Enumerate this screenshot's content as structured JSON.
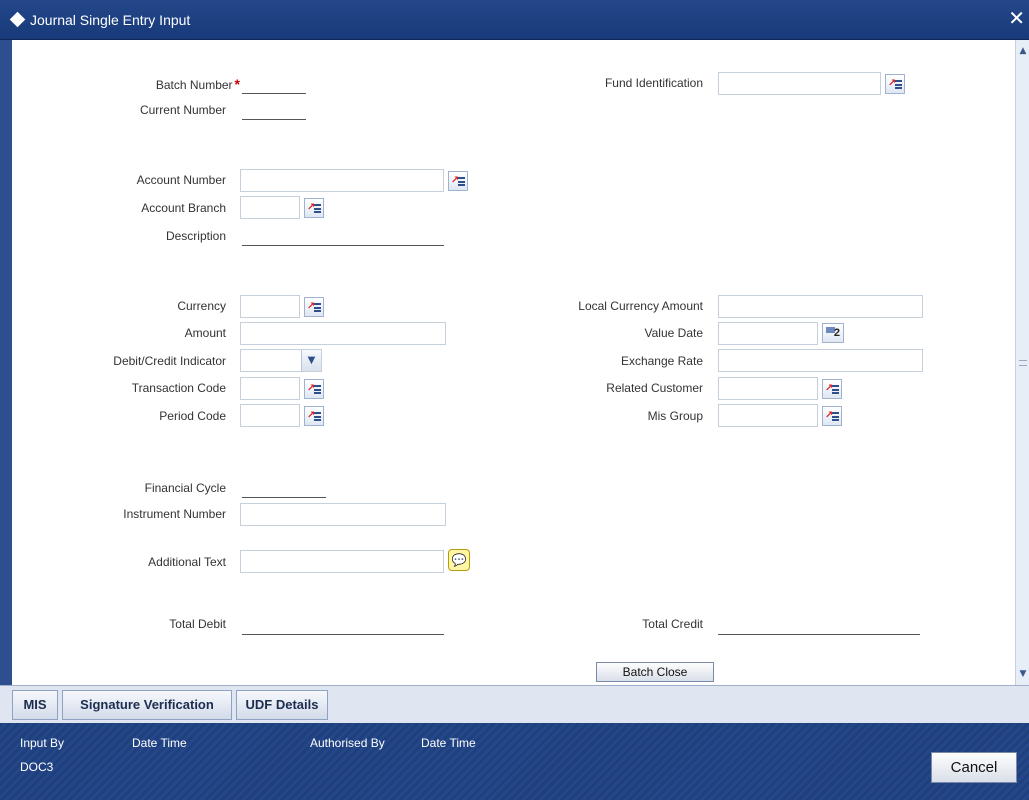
{
  "window": {
    "title": "Journal Single Entry Input",
    "close_symbol": "✕"
  },
  "form": {
    "batch_number": {
      "label": "Batch Number",
      "required_mark": "*",
      "value": ""
    },
    "current_number": {
      "label": "Current Number",
      "value": ""
    },
    "fund_identification": {
      "label": "Fund Identification",
      "value": ""
    },
    "account_number": {
      "label": "Account Number",
      "value": ""
    },
    "account_branch": {
      "label": "Account Branch",
      "value": ""
    },
    "description": {
      "label": "Description",
      "value": ""
    },
    "currency": {
      "label": "Currency",
      "value": ""
    },
    "amount": {
      "label": "Amount",
      "value": ""
    },
    "debit_credit_indicator": {
      "label": "Debit/Credit Indicator",
      "value": ""
    },
    "transaction_code": {
      "label": "Transaction Code",
      "value": ""
    },
    "period_code": {
      "label": "Period Code",
      "value": ""
    },
    "local_currency_amount": {
      "label": "Local Currency Amount",
      "value": ""
    },
    "value_date": {
      "label": "Value Date",
      "value": "",
      "calendar_glyph": "2"
    },
    "exchange_rate": {
      "label": "Exchange Rate",
      "value": ""
    },
    "related_customer": {
      "label": "Related Customer",
      "value": ""
    },
    "mis_group": {
      "label": "Mis Group",
      "value": ""
    },
    "financial_cycle": {
      "label": "Financial Cycle",
      "value": ""
    },
    "instrument_number": {
      "label": "Instrument Number",
      "value": ""
    },
    "additional_text": {
      "label": "Additional Text",
      "value": ""
    },
    "total_debit": {
      "label": "Total Debit",
      "value": ""
    },
    "total_credit": {
      "label": "Total Credit",
      "value": ""
    },
    "batch_close_label": "Batch Close"
  },
  "tabs": [
    {
      "label": "MIS"
    },
    {
      "label": "Signature Verification"
    },
    {
      "label": "UDF Details"
    }
  ],
  "footer": {
    "input_by_label": "Input By",
    "input_by_value": "DOC3",
    "date_time_label_1": "Date Time",
    "authorised_by_label": "Authorised By",
    "date_time_label_2": "Date Time",
    "cancel_label": "Cancel"
  },
  "icons": {
    "lov": "list-of-values-icon",
    "calendar": "calendar-icon",
    "note": "speech-bubble-icon",
    "dropdown": "chevron-down-icon",
    "title": "diamond-icon"
  },
  "colors": {
    "title_bar": "#1f3f7d",
    "required_mark": "#cc0000",
    "footer": "#1f3f7d"
  }
}
